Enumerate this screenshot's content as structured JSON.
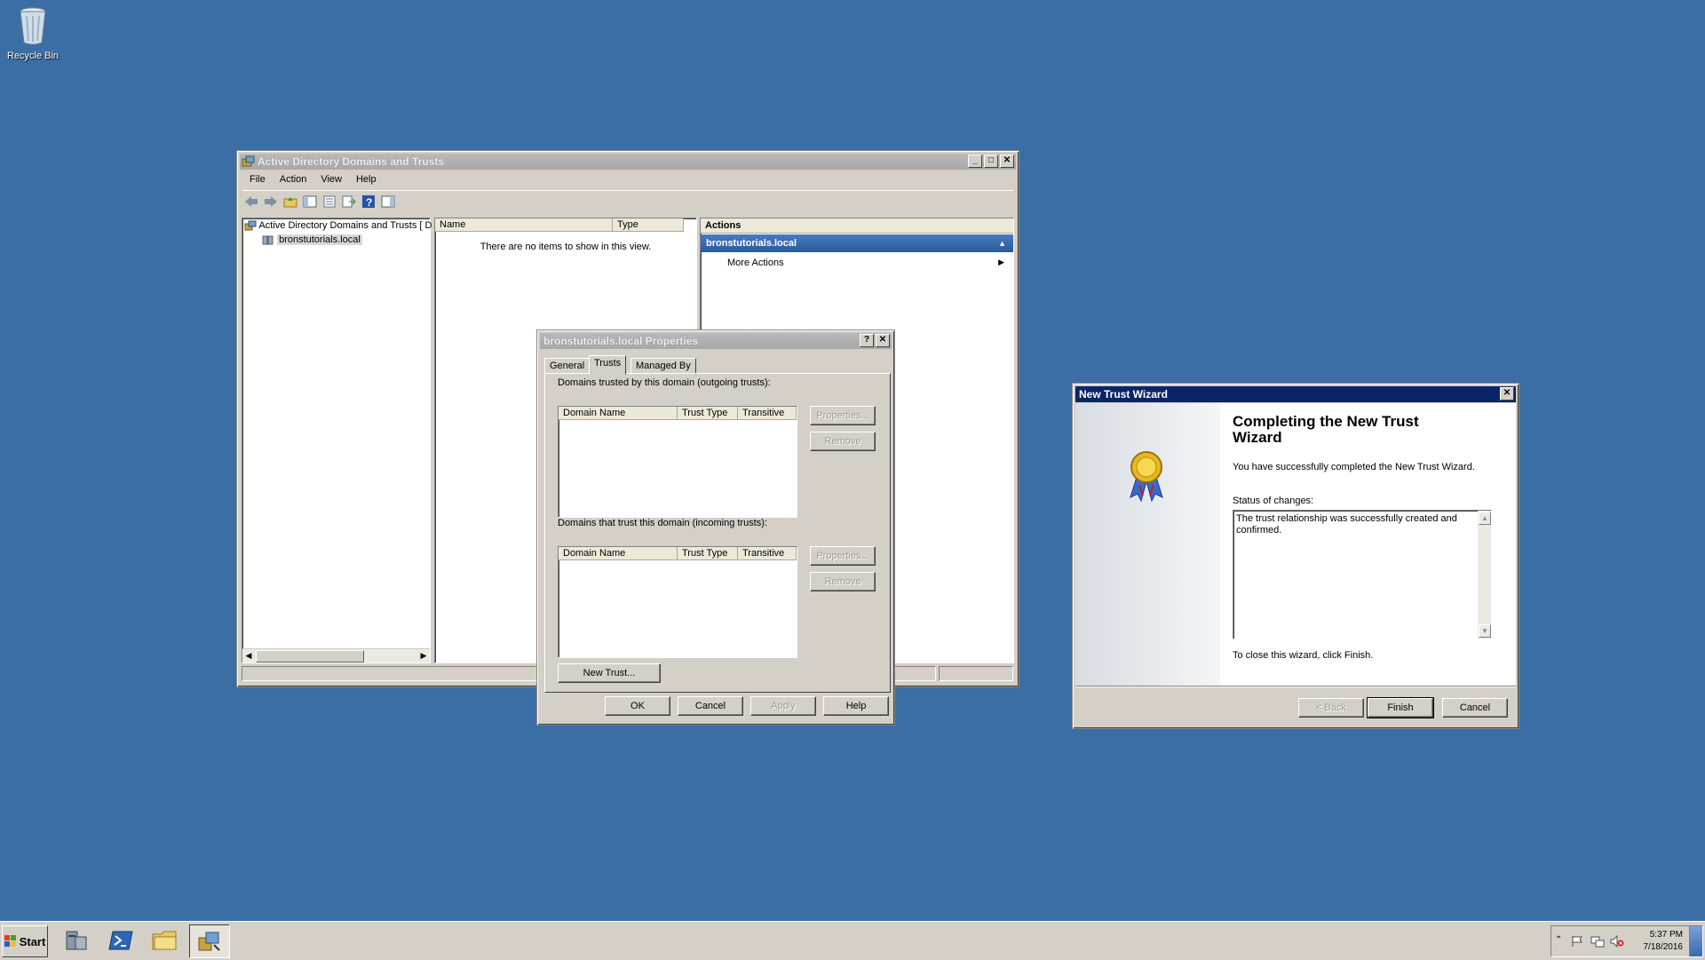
{
  "desktop": {
    "recycle_bin_label": "Recycle Bin"
  },
  "mmc": {
    "title": "Active Directory Domains and Trusts",
    "menu": [
      "File",
      "Action",
      "View",
      "Help"
    ],
    "tree_root": "Active Directory Domains and Trusts [ D",
    "tree_child": "bronstutorials.local",
    "col_name": "Name",
    "col_type": "Type",
    "empty_text": "There are no items to show in this view.",
    "actions_header": "Actions",
    "actions_selected": "bronstutorials.local",
    "more_actions": "More Actions"
  },
  "props": {
    "title": "bronstutorials.local Properties",
    "tabs": [
      "General",
      "Trusts",
      "Managed By"
    ],
    "outgoing_label": "Domains trusted by this domain (outgoing trusts):",
    "incoming_label": "Domains that trust this domain (incoming trusts):",
    "col_domain": "Domain Name",
    "col_trust_type": "Trust Type",
    "col_transitive": "Transitive",
    "properties_btn": "Properties...",
    "remove_btn": "Remove",
    "new_trust_btn": "New Trust...",
    "ok": "OK",
    "cancel": "Cancel",
    "apply": "Apply",
    "help": "Help"
  },
  "wizard": {
    "title": "New Trust Wizard",
    "heading": "Completing the New Trust Wizard",
    "success_text": "You have successfully completed the New Trust Wizard.",
    "status_label": "Status of changes:",
    "status_value": "The trust relationship was successfully created and confirmed.",
    "close_text": "To close this wizard, click Finish.",
    "back": "< Back",
    "finish": "Finish",
    "cancel": "Cancel"
  },
  "taskbar": {
    "start_label": "Start",
    "time": "5:37 PM",
    "date": "7/18/2016"
  }
}
